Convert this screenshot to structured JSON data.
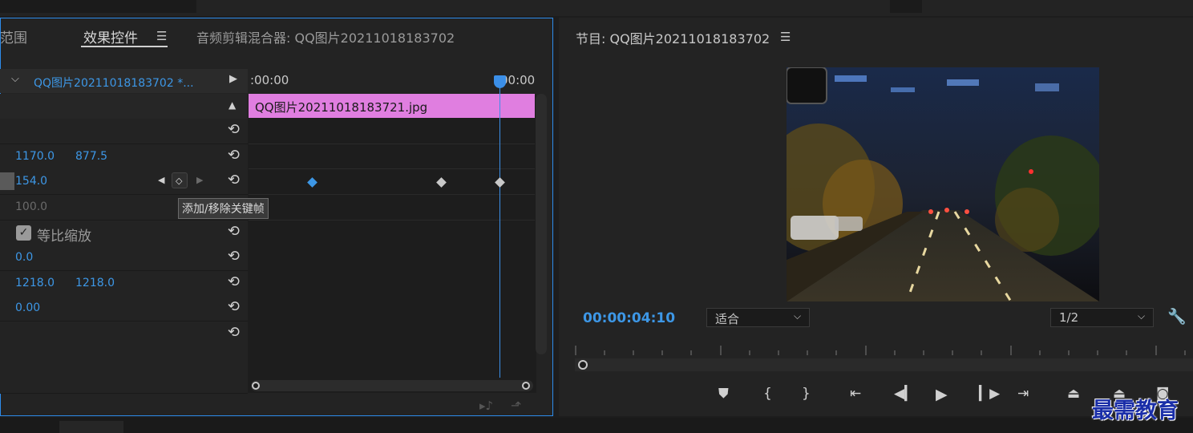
{
  "left_panel": {
    "tabs": [
      {
        "label": "范围"
      },
      {
        "label": "效果控件"
      },
      {
        "label": "音频剪辑混合器: QQ图片20211018183702"
      }
    ],
    "clip_name": "QQ图片20211018183702 *...",
    "ruler_start": ":00:00",
    "ruler_end": "00:00",
    "timeline_clip": "QQ图片20211018183721.jpg",
    "tooltip": "添加/移除关键帧",
    "rows": {
      "position_x": "1170.0",
      "position_y": "877.5",
      "scale": "154.0",
      "scale_width": "100.0",
      "uniform_scale_label": "等比缩放",
      "rotation": "0.0",
      "anchor_x": "1218.0",
      "anchor_y": "1218.0",
      "flicker": "0.00"
    }
  },
  "program_monitor": {
    "title": "节目: QQ图片20211018183702",
    "timecode": "00:00:04:10",
    "fit_label": "适合",
    "resolution": "1/2"
  },
  "icons": {
    "menu": "hamburger-icon",
    "reset": "reset-icon",
    "wrench": "wrench-icon"
  },
  "colors": {
    "accent": "#3d97e6",
    "clip": "#e07ee0",
    "panel_border": "#2d8ceb"
  },
  "watermark": "最需教育"
}
